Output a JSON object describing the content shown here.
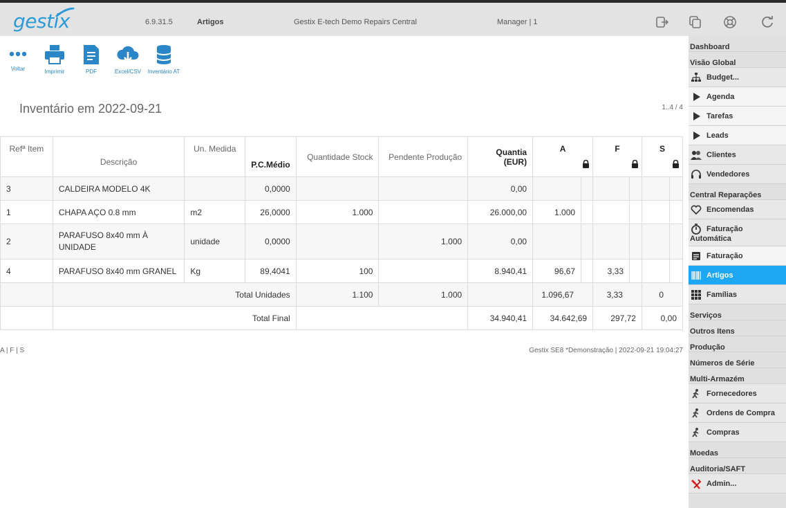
{
  "header": {
    "logo": "gestix",
    "version": "6.9.31.5",
    "module": "Artigos",
    "company": "Gestix E-tech Demo Repairs Central",
    "user": "Manager | 1",
    "icons": [
      "logout-icon",
      "windows-icon",
      "help-lifebuoy-icon",
      "refresh-icon"
    ]
  },
  "toolbar": [
    {
      "name": "voltar-button",
      "icon": "dots-icon",
      "label": "Voltar"
    },
    {
      "name": "imprimir-button",
      "icon": "printer-icon",
      "label": "Imprimir"
    },
    {
      "name": "pdf-button",
      "icon": "document-icon",
      "label": "PDF"
    },
    {
      "name": "excel-csv-button",
      "icon": "cloud-download-icon",
      "label": "Excel/CSV"
    },
    {
      "name": "inventario-at-button",
      "icon": "database-icon",
      "label": "Inventário AT"
    }
  ],
  "page": {
    "title": "Inventário em 2022-09-21",
    "pager": "1..4 / 4"
  },
  "table": {
    "headers": {
      "ref": "Refª Item",
      "descricao": "Descrição",
      "unidade": "Un. Medida",
      "pcmedio": "P.C.Médio",
      "quantidade": "Quantidade Stock",
      "pendente": "Pendente Produção",
      "quantia": "Quantia (EUR)",
      "a": "A",
      "f": "F",
      "s": "S"
    },
    "rows": [
      {
        "ref": "3",
        "descricao": "CALDEIRA MODELO 4K",
        "unidade": "",
        "pcmedio": "0,0000",
        "quantidade": "",
        "pendente": "",
        "quantia": "0,00",
        "a": "",
        "f": "",
        "s": ""
      },
      {
        "ref": "1",
        "descricao": "CHAPA AÇO 0.8 mm",
        "unidade": "m2",
        "pcmedio": "26,0000",
        "quantidade": "1.000",
        "pendente": "",
        "quantia": "26.000,00",
        "a": "1.000",
        "f": "",
        "s": ""
      },
      {
        "ref": "2",
        "descricao": "PARAFUSO 8x40 mm À UNIDADE",
        "unidade": "unidade",
        "pcmedio": "0,0000",
        "quantidade": "",
        "pendente": "1.000",
        "quantia": "0,00",
        "a": "",
        "f": "",
        "s": ""
      },
      {
        "ref": "4",
        "descricao": "PARAFUSO 8x40 mm GRANEL",
        "unidade": "Kg",
        "pcmedio": "89,4041",
        "quantidade": "100",
        "pendente": "",
        "quantia": "8.940,41",
        "a": "96,67",
        "f": "3,33",
        "s": ""
      }
    ],
    "total_unidades": {
      "label": "Total Unidades",
      "quantidade": "1.100",
      "pendente": "1.000",
      "a": "1.096,67",
      "f": "3,33",
      "s": "0"
    },
    "total_final": {
      "label": "Total Final",
      "quantia": "34.940,41",
      "a": "34.642,69",
      "f": "297,72",
      "s": "0,00"
    }
  },
  "footer": {
    "legend": "A | F | S",
    "info": "Gestix SE8 *Demonstração | 2022-09-21 19:04:27"
  },
  "sidebar": [
    {
      "label": "Dashboard",
      "icon": "",
      "kind": "plain"
    },
    {
      "label": "Visão Global",
      "icon": "",
      "kind": "plain"
    },
    {
      "label": "Budget...",
      "icon": "org-chart-icon",
      "kind": "icon"
    },
    {
      "label": "Agenda",
      "icon": "play-icon",
      "kind": "icon-white"
    },
    {
      "label": "Tarefas",
      "icon": "play-icon",
      "kind": "icon-white"
    },
    {
      "label": "Leads",
      "icon": "play-icon",
      "kind": "icon-white"
    },
    {
      "label": "Clientes",
      "icon": "users-icon",
      "kind": "icon"
    },
    {
      "label": "Vendedores",
      "icon": "headset-icon",
      "kind": "icon"
    },
    {
      "label": "Central Reparações",
      "icon": "",
      "kind": "plain"
    },
    {
      "label": "Encomendas",
      "icon": "heart-icon",
      "kind": "icon"
    },
    {
      "label": "Faturação",
      "label2": "Automática",
      "icon": "stopwatch-icon",
      "kind": "double"
    },
    {
      "label": "Faturação",
      "icon": "invoice-icon",
      "kind": "icon-white"
    },
    {
      "label": "Artigos",
      "icon": "barcode-icon",
      "kind": "active"
    },
    {
      "label": "Famílias",
      "icon": "grid-icon",
      "kind": "icon"
    },
    {
      "label": "Serviços",
      "icon": "",
      "kind": "plain"
    },
    {
      "label": "Outros Itens",
      "icon": "",
      "kind": "plain"
    },
    {
      "label": "Produção",
      "icon": "",
      "kind": "plain"
    },
    {
      "label": "Números de Série",
      "icon": "",
      "kind": "plain"
    },
    {
      "label": "Multi-Armazém",
      "icon": "",
      "kind": "plain"
    },
    {
      "label": "Fornecedores",
      "icon": "worker-icon",
      "kind": "icon"
    },
    {
      "label": "Ordens de Compra",
      "icon": "worker-icon",
      "kind": "icon"
    },
    {
      "label": "Compras",
      "icon": "worker-icon",
      "kind": "icon"
    },
    {
      "label": "Moedas",
      "icon": "",
      "kind": "plain"
    },
    {
      "label": "Auditoria/SAFT",
      "icon": "",
      "kind": "plain"
    },
    {
      "label": "Admin...",
      "icon": "admin-tools-icon",
      "kind": "icon"
    }
  ],
  "colors": {
    "accent": "#1ea7f2",
    "toolbar_icon": "#2b86c7",
    "logo": "#2d9ad8"
  }
}
